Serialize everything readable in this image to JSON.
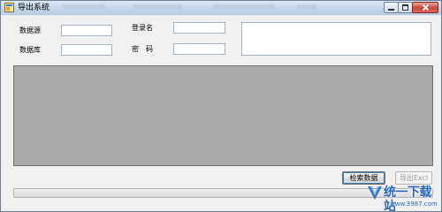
{
  "window": {
    "title": "导出系统"
  },
  "form": {
    "datasource_label": "数据源",
    "database_label": "数据库",
    "login_label": "登录名",
    "password_label": "密　码",
    "datasource_value": "",
    "database_value": "",
    "login_value": "",
    "password_value": ""
  },
  "buttons": {
    "search_label": "检索数据",
    "export_label": "导出Excl"
  },
  "progress": {
    "value": 0
  },
  "watermark": {
    "name": "统一下载站",
    "url": "www.3987.com"
  },
  "colors": {
    "grid_bg": "#a9a9a9",
    "titlebar": "#c3d4e8",
    "close_button": "#c8453a",
    "watermark": "#2a66b8"
  }
}
